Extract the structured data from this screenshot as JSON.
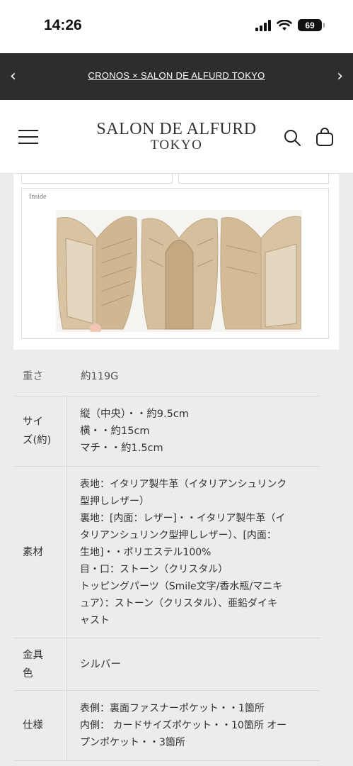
{
  "status_bar": {
    "time": "14:26",
    "battery": "69",
    "icons": [
      "signal-icon",
      "wifi-icon",
      "battery-icon"
    ]
  },
  "announcement": {
    "text": "CRONOS × SALON DE ALFURD TOKYO",
    "prev_icon": "chevron-left-icon",
    "next_icon": "chevron-right-icon"
  },
  "header": {
    "logo_main": "SALON DE ALFURD",
    "logo_sub": "TOKYO",
    "icons": [
      "menu-icon",
      "search-icon",
      "shopping-bag-icon"
    ]
  },
  "gallery": {
    "inside_label": "Inside"
  },
  "spec_table": [
    {
      "label_lines": [
        "重さ"
      ],
      "value_lines": [
        "約119G"
      ]
    },
    {
      "label_lines": [
        "サイ",
        "ズ(約)"
      ],
      "value_lines": [
        "縦（中央）・・約9.5cm",
        "横・・約15cm",
        "マチ・・約1.5cm"
      ]
    },
    {
      "label_lines": [
        "素材"
      ],
      "value_lines": [
        "表地：イタリア製牛革（イタリアンシュリンク",
        "型押しレザー）",
        "裏地：[内面：レザー]・・イタリア製牛革（イ",
        "タリアンシュリンク型押しレザー）、[内面：",
        "生地]・・ポリエステル100%",
        "目・口：ストーン（クリスタル）",
        "トッピングパーツ（Smile文字/香水瓶/マニキ",
        "ュア）：ストーン（クリスタル）、亜鉛ダイキ",
        "ャスト"
      ]
    },
    {
      "label_lines": [
        "金具",
        "色"
      ],
      "value_lines": [
        "シルバー"
      ]
    },
    {
      "label_lines": [
        "仕様"
      ],
      "value_lines": [
        "表側：裏面ファスナーポケット・・1箇所",
        "内側： カードサイズポケット・・10箇所 オー",
        "プンポケット・・3箇所"
      ]
    }
  ]
}
